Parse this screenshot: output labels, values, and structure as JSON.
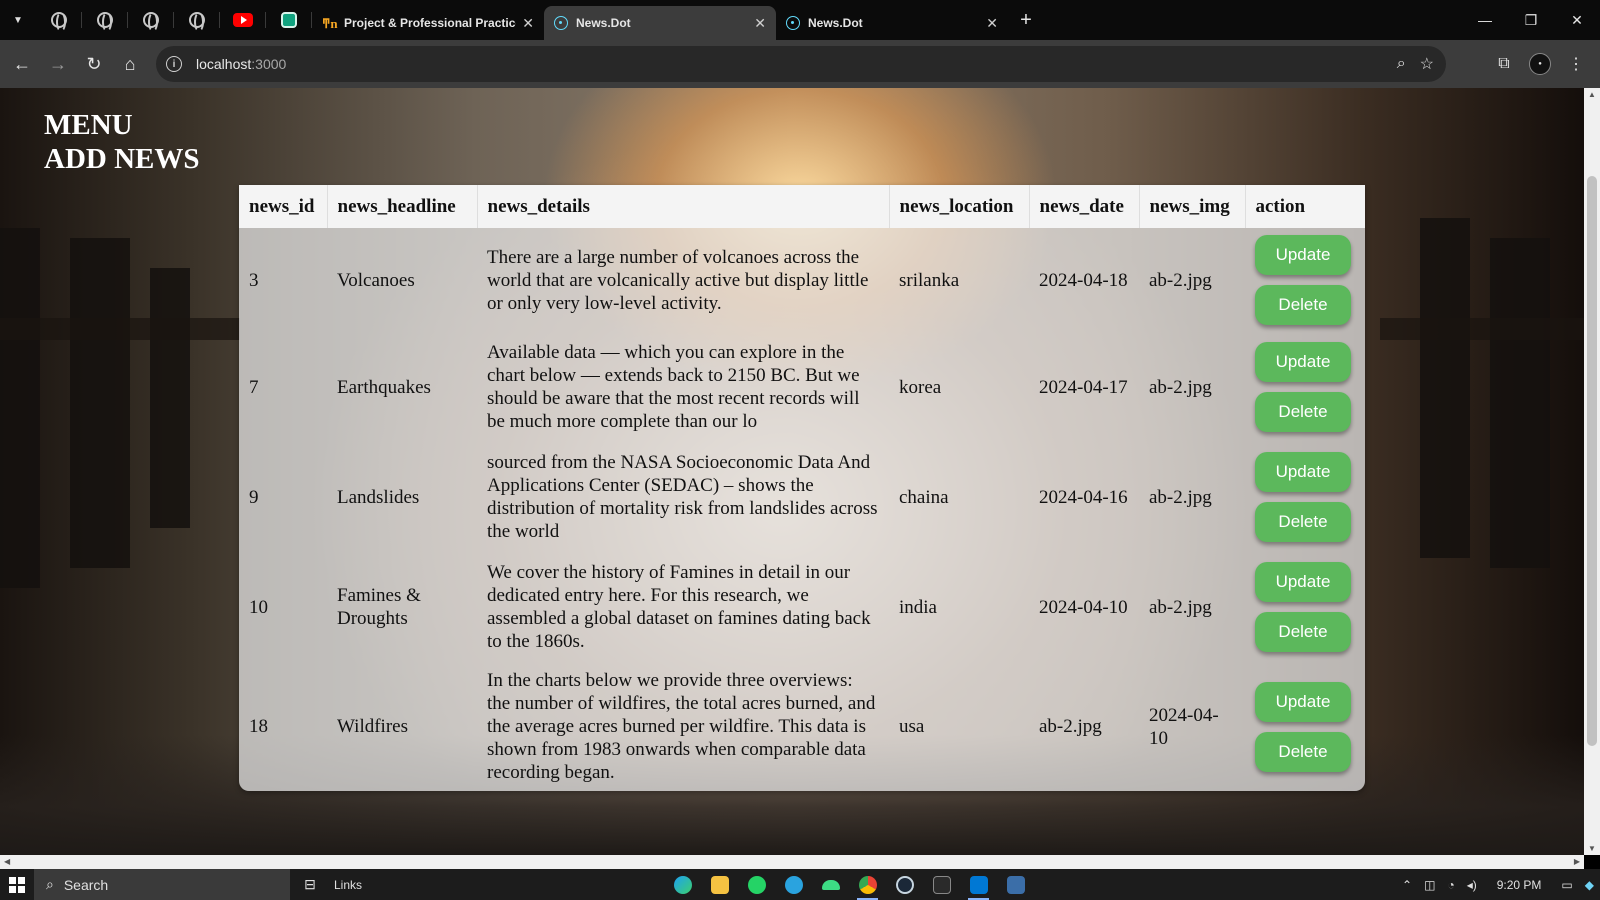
{
  "browser": {
    "pinned_tabs": [
      "globe-icon",
      "globe-icon",
      "globe-icon",
      "globe-icon",
      "youtube-icon",
      "chatgpt-icon"
    ],
    "tabs": [
      {
        "title": "Project & Professional Practice",
        "active": false
      },
      {
        "title": "News.Dot",
        "active": true
      },
      {
        "title": "News.Dot",
        "active": false
      }
    ],
    "new_tab": "+",
    "address": {
      "host": "localhost",
      "port": ":3000"
    },
    "window_controls": {
      "minimize": "—",
      "restore": "❐",
      "close": "✕"
    }
  },
  "page": {
    "menu": {
      "menu_label": "MENU",
      "add_news_label": "ADD NEWS"
    },
    "table": {
      "columns": [
        "news_id",
        "news_headline",
        "news_details",
        "news_location",
        "news_date",
        "news_img",
        "action"
      ],
      "rows": [
        {
          "id": "3",
          "headline": "Volcanoes",
          "details": "There are a large number of volcanoes across the world that are volcanically active but display little or only very low-level activity.",
          "location": "srilanka",
          "date": "2024-04-18",
          "img": "ab-2.jpg"
        },
        {
          "id": "7",
          "headline": "Earthquakes",
          "details": "Available data — which you can explore in the chart below — extends back to 2150 BC. But we should be aware that the most recent records will be much more complete than our lo",
          "location": "korea",
          "date": "2024-04-17",
          "img": "ab-2.jpg"
        },
        {
          "id": "9",
          "headline": "Landslides",
          "details": "sourced from the NASA Socioeconomic Data And Applications Center (SEDAC) – shows the distribution of mortality risk from landslides across the world",
          "location": "chaina",
          "date": "2024-04-16",
          "img": "ab-2.jpg"
        },
        {
          "id": "10",
          "headline": "Famines & Droughts",
          "details": "We cover the history of Famines in detail in our dedicated entry here. For this research, we assembled a global dataset on famines dating back to the 1860s.",
          "location": "india",
          "date": "2024-04-10",
          "img": "ab-2.jpg"
        },
        {
          "id": "18",
          "headline": "Wildfires",
          "details": "In the charts below we provide three overviews: the number of wildfires, the total acres burned, and the average acres burned per wildfire. This data is shown from 1983 onwards when comparable data recording began.",
          "location": "usa",
          "date": "ab-2.jpg",
          "img": "2024-04-10"
        }
      ],
      "update_label": "Update",
      "delete_label": "Delete"
    }
  },
  "taskbar": {
    "search_placeholder": "Search",
    "links_label": "Links",
    "time": "9:20 PM",
    "apps": [
      "edge-icon",
      "file-explorer-icon",
      "whatsapp-icon",
      "telegram-icon",
      "android-icon",
      "chrome-icon",
      "steam-icon",
      "epic-games-icon",
      "vscode-icon",
      "app-icon"
    ]
  },
  "colors": {
    "button_green": "#5cb85c",
    "menu_text": "#ffffff",
    "active_tab": "#3c3c3c"
  }
}
